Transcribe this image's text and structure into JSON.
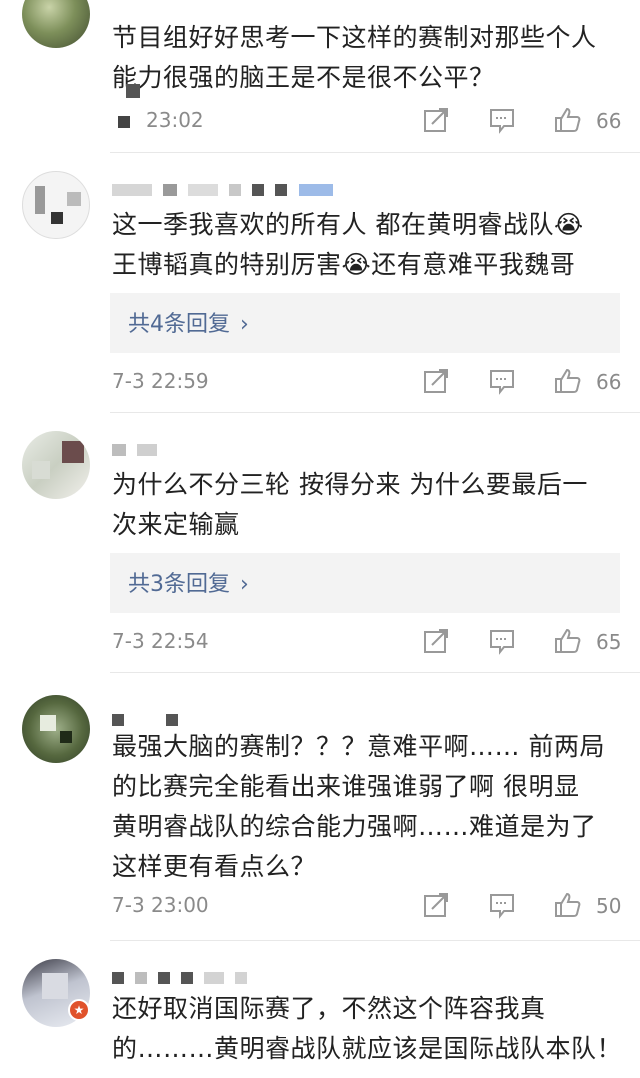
{
  "comments": [
    {
      "lines": [
        "节目组好好思考一下这样的赛制对那些个人",
        "能力很强的脑王是不是很不公平？"
      ],
      "time": "23:02",
      "likes": "66"
    },
    {
      "lines": [
        "这一季我喜欢的所有人 都在黄明睿战队😭",
        "王博韬真的特别厉害😭还有意难平我魏哥"
      ],
      "reply_label": "共4条回复",
      "time": "7-3 22:59",
      "likes": "66"
    },
    {
      "lines": [
        "为什么不分三轮 按得分来 为什么要最后一",
        "次来定输赢"
      ],
      "reply_label": "共3条回复",
      "time": "7-3 22:54",
      "likes": "65"
    },
    {
      "lines": [
        "最强大脑的赛制？？？意难平啊…… 前两局",
        "的比赛完全能看出来谁强谁弱了啊 很明显",
        "黄明睿战队的综合能力强啊……难道是为了",
        "这样更有看点么？"
      ],
      "time": "7-3 23:00",
      "likes": "50"
    },
    {
      "lines": [
        "还好取消国际赛了，不然这个阵容我真",
        "的………黄明睿战队就应该是国际战队本队！"
      ]
    }
  ],
  "icons": {
    "share": "share-icon",
    "comment": "comment-icon",
    "like": "thumbs-up-icon"
  },
  "colors": {
    "link": "#516a94",
    "meta": "#8a8a8a",
    "reply_bg": "#f3f3f3"
  }
}
